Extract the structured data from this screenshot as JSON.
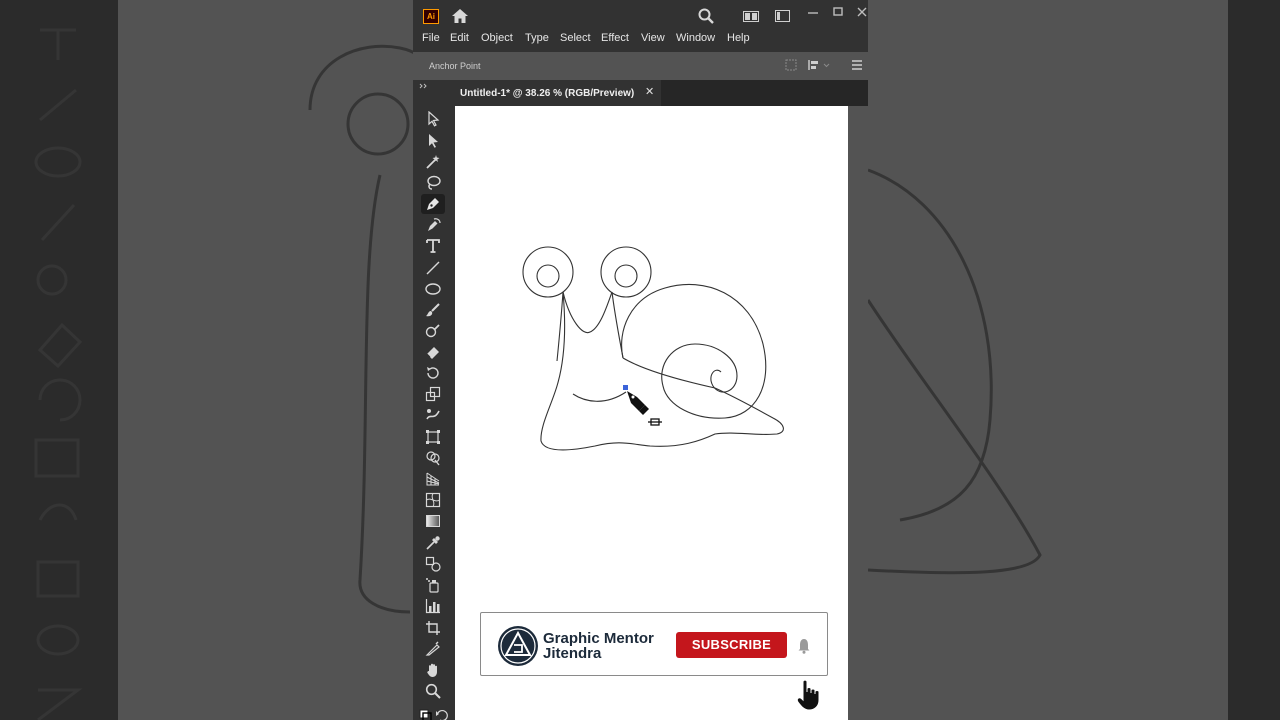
{
  "app": {
    "logo_text": "Ai",
    "colors": {
      "logo_bg": "#330000",
      "logo_fg": "#ff9a00",
      "ui_dark": "#323232",
      "canvas": "#535353",
      "subscribe_red": "#c4161c"
    }
  },
  "menu": [
    {
      "label": "File"
    },
    {
      "label": "Edit"
    },
    {
      "label": "Object"
    },
    {
      "label": "Type"
    },
    {
      "label": "Select"
    },
    {
      "label": "Effect"
    },
    {
      "label": "View"
    },
    {
      "label": "Window"
    },
    {
      "label": "Help"
    }
  ],
  "control_bar": {
    "label": "Anchor Point"
  },
  "document_tab": {
    "title": "Untitled-1* @ 38.26 % (RGB/Preview)",
    "close": "✕"
  },
  "tools": [
    {
      "icon": "selection-tool-icon"
    },
    {
      "icon": "direct-selection-tool-icon"
    },
    {
      "icon": "magic-wand-tool-icon"
    },
    {
      "icon": "lasso-tool-icon"
    },
    {
      "icon": "pen-tool-icon",
      "active": true
    },
    {
      "icon": "curvature-tool-icon"
    },
    {
      "icon": "type-tool-icon"
    },
    {
      "icon": "line-tool-icon"
    },
    {
      "icon": "ellipse-tool-icon"
    },
    {
      "icon": "paintbrush-tool-icon"
    },
    {
      "icon": "shaper-tool-icon"
    },
    {
      "icon": "eraser-tool-icon"
    },
    {
      "icon": "rotate-tool-icon"
    },
    {
      "icon": "scale-tool-icon"
    },
    {
      "icon": "puppet-warp-tool-icon"
    },
    {
      "icon": "free-transform-tool-icon"
    },
    {
      "icon": "shape-builder-tool-icon"
    },
    {
      "icon": "perspective-grid-tool-icon"
    },
    {
      "icon": "mesh-tool-icon"
    },
    {
      "icon": "gradient-tool-icon"
    },
    {
      "icon": "eyedropper-tool-icon"
    },
    {
      "icon": "blend-tool-icon"
    },
    {
      "icon": "symbol-sprayer-tool-icon"
    },
    {
      "icon": "graph-tool-icon"
    },
    {
      "icon": "artboard-tool-icon"
    },
    {
      "icon": "slice-tool-icon"
    },
    {
      "icon": "hand-tool-icon"
    },
    {
      "icon": "zoom-tool-icon"
    }
  ],
  "subscribe_card": {
    "name_line1": "Graphic Mentor",
    "name_line2": "Jitendra",
    "button": "SUBSCRIBE",
    "logo_letter": "G"
  }
}
